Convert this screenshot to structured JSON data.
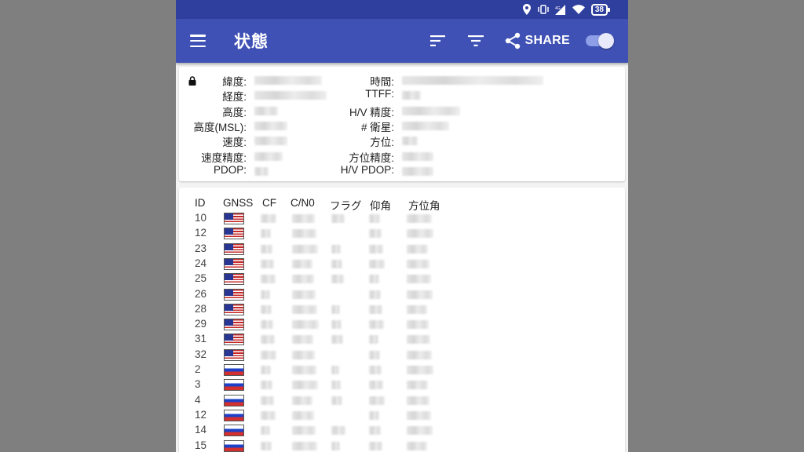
{
  "appbar": {
    "title": "状態",
    "share_label": "SHARE"
  },
  "statusbar": {
    "battery": "38"
  },
  "status": {
    "left_labels": [
      "緯度:",
      "経度:",
      "高度:",
      "高度(MSL):",
      "速度:",
      "速度精度:",
      "PDOP:"
    ],
    "right_labels": [
      "時間:",
      "TTFF:",
      "H/V 精度:",
      "# 衛星:",
      "方位:",
      "方位精度:",
      "H/V PDOP:"
    ]
  },
  "satellites": {
    "headers": [
      "ID",
      "GNSS",
      "CF",
      "C/N0",
      "フラグ",
      "仰角",
      "方位角"
    ],
    "rows": [
      {
        "id": "10",
        "gnss": "us"
      },
      {
        "id": "12",
        "gnss": "us"
      },
      {
        "id": "23",
        "gnss": "us"
      },
      {
        "id": "24",
        "gnss": "us"
      },
      {
        "id": "25",
        "gnss": "us"
      },
      {
        "id": "26",
        "gnss": "us"
      },
      {
        "id": "28",
        "gnss": "us"
      },
      {
        "id": "29",
        "gnss": "us"
      },
      {
        "id": "31",
        "gnss": "us"
      },
      {
        "id": "32",
        "gnss": "us"
      },
      {
        "id": "2",
        "gnss": "ru"
      },
      {
        "id": "3",
        "gnss": "ru"
      },
      {
        "id": "4",
        "gnss": "ru"
      },
      {
        "id": "12",
        "gnss": "ru"
      },
      {
        "id": "14",
        "gnss": "ru"
      },
      {
        "id": "15",
        "gnss": "ru"
      }
    ]
  },
  "colors": {
    "appbar": "#3f51b5",
    "statusbar": "#2f3f9e",
    "toggle": "#8e9fe8"
  }
}
